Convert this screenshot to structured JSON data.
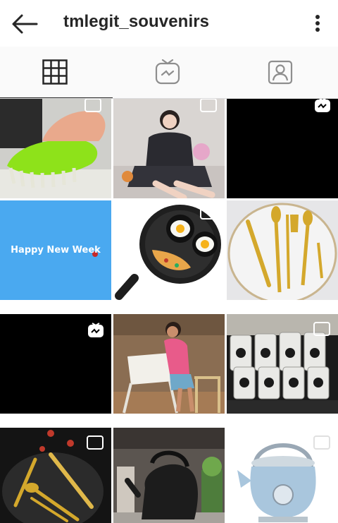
{
  "header": {
    "title": "tmlegit_souvenirs",
    "back_icon": "arrow-left-icon",
    "menu_icon": "more-vertical-icon"
  },
  "tabs": [
    {
      "name": "grid",
      "icon": "grid-icon",
      "active": true
    },
    {
      "name": "igtv",
      "icon": "igtv-icon",
      "active": false
    },
    {
      "name": "tagged",
      "icon": "tagged-user-icon",
      "active": false
    }
  ],
  "posts": [
    {
      "subject": "green scrub brush",
      "badge": "multi-image-icon"
    },
    {
      "subject": "woman in pajamas",
      "badge": "multi-image-icon"
    },
    {
      "subject": "black video",
      "badge": "igtv-icon"
    },
    {
      "subject": "happy new week card",
      "caption": "Happy New Week",
      "badge": null
    },
    {
      "subject": "frying pan with eggs",
      "badge": "multi-image-icon"
    },
    {
      "subject": "gold cutlery on plate",
      "badge": null
    },
    {
      "subject": "black video",
      "badge": "igtv-icon"
    },
    {
      "subject": "girl at tray table",
      "badge": null
    },
    {
      "subject": "kitchen gadgets in packs",
      "badge": "multi-image-icon"
    },
    {
      "subject": "gold cutlery on dark",
      "badge": "multi-image-icon"
    },
    {
      "subject": "black kettle",
      "badge": null
    },
    {
      "subject": "blue kettle",
      "badge": "multi-image-icon"
    }
  ],
  "colors": {
    "text": "#262626",
    "tab_bg": "#fafafa",
    "divider": "#dbdbdb",
    "card_blue": "#4aa9f0",
    "accent_green": "#8ee21a",
    "gold": "#d4a82c"
  }
}
